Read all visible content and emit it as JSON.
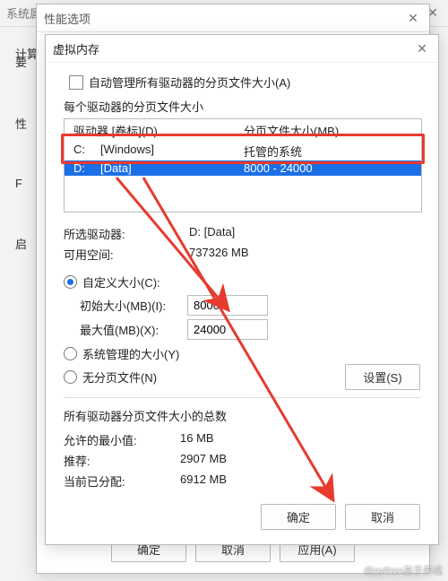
{
  "sys_window": {
    "title": "系统属",
    "tab": "计算",
    "rows": [
      "要",
      "性",
      "F",
      "启"
    ]
  },
  "perf_window": {
    "title": "性能选项",
    "ok": "确定",
    "cancel": "取消",
    "apply": "应用(A)"
  },
  "vm_dialog": {
    "title": "虚拟内存",
    "auto_manage": "自动管理所有驱动器的分页文件大小(A)",
    "each_drive_label": "每个驱动器的分页文件大小",
    "header_drive": "驱动器 [卷标](D)",
    "header_size": "分页文件大小(MB)",
    "drives": [
      {
        "letter": "C:",
        "label": "[Windows]",
        "size": "托管的系统"
      },
      {
        "letter": "D:",
        "label": "[Data]",
        "size": "8000 - 24000"
      }
    ],
    "selected_drive_label": "所选驱动器:",
    "selected_drive_value": "D:  [Data]",
    "available_label": "可用空间:",
    "available_value": "737326 MB",
    "custom_label": "自定义大小(C):",
    "initial_label": "初始大小(MB)(I):",
    "initial_value": "8000",
    "max_label": "最大值(MB)(X):",
    "max_value": "24000",
    "system_managed": "系统管理的大小(Y)",
    "no_paging": "无分页文件(N)",
    "set_btn": "设置(S)",
    "totals_title": "所有驱动器分页文件大小的总数",
    "min_allowed_label": "允许的最小值:",
    "min_allowed_value": "16 MB",
    "recommended_label": "推荐:",
    "recommended_value": "2907 MB",
    "current_label": "当前已分配:",
    "current_value": "6912 MB",
    "ok": "确定",
    "cancel": "取消"
  },
  "watermark": "@python高手养成"
}
